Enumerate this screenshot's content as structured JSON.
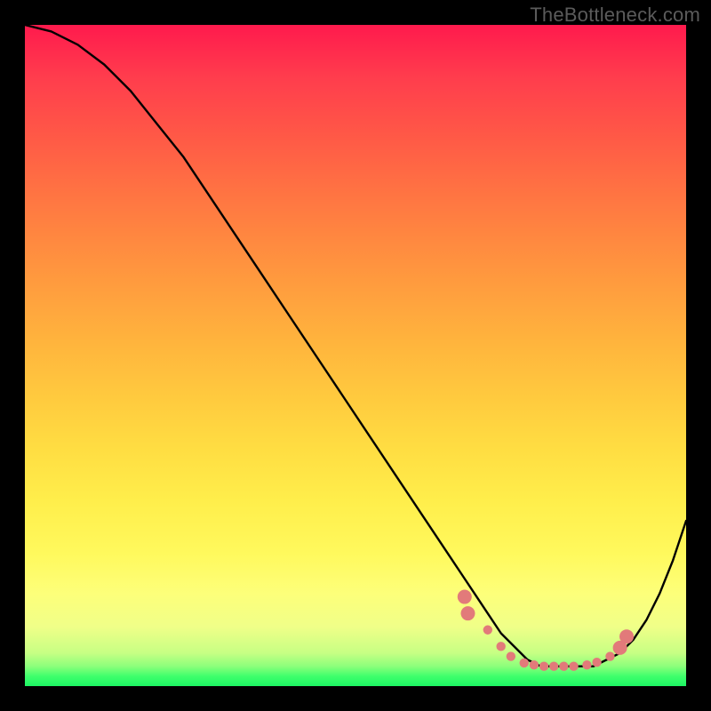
{
  "watermark": "TheBottleneck.com",
  "colors": {
    "dot": "#e27a7a",
    "curve": "#000000",
    "frame": "#000000"
  },
  "chart_data": {
    "type": "line",
    "title": "",
    "xlabel": "",
    "ylabel": "",
    "xlim": [
      0,
      100
    ],
    "ylim": [
      0,
      100
    ],
    "grid": false,
    "legend": false,
    "series": [
      {
        "name": "bottleneck-curve",
        "x": [
          0,
          4,
          8,
          12,
          16,
          20,
          24,
          28,
          32,
          36,
          40,
          44,
          48,
          52,
          56,
          60,
          64,
          66,
          68,
          70,
          72,
          74,
          76,
          78,
          80,
          82,
          84,
          86,
          88,
          90,
          92,
          94,
          96,
          98,
          100
        ],
        "y": [
          100,
          99,
          97,
          94,
          90,
          85,
          80,
          74,
          68,
          62,
          56,
          50,
          44,
          38,
          32,
          26,
          20,
          17,
          14,
          11,
          8,
          6,
          4,
          3,
          3,
          3,
          3,
          3,
          4,
          5,
          7,
          10,
          14,
          19,
          25
        ]
      }
    ],
    "highlight_points": {
      "name": "optimal-range-dots",
      "x": [
        66.5,
        67,
        70,
        72,
        73.5,
        75.5,
        77,
        78.5,
        80,
        81.5,
        83,
        85,
        86.5,
        88.5,
        90,
        91
      ],
      "y": [
        13.5,
        11,
        8.5,
        6,
        4.5,
        3.5,
        3.2,
        3,
        3,
        3,
        3,
        3.2,
        3.6,
        4.5,
        5.8,
        7.5
      ]
    }
  }
}
